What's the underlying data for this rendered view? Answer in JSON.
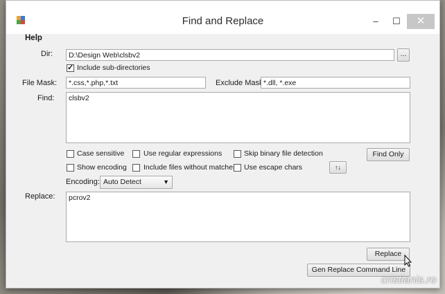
{
  "window": {
    "title": "Find and Replace"
  },
  "titlebar": {
    "min_glyph": "–",
    "max_glyph": "☐",
    "close_glyph": "✕"
  },
  "menu": {
    "help": "Help"
  },
  "dir": {
    "label": "Dir:",
    "value": "D:\\Design Web\\clsbv2",
    "browse_label": "..."
  },
  "subdirs": {
    "label": "Include sub-directories",
    "checked": true
  },
  "file_mask": {
    "label": "File Mask:",
    "value": "*.css,*.php,*.txt"
  },
  "exclude_mask": {
    "label": "Exclude Mask:",
    "value": "*.dll, *.exe"
  },
  "find": {
    "label": "Find:",
    "value": "clsbv2"
  },
  "options": {
    "case_sensitive": "Case sensitive",
    "regex": "Use regular expressions",
    "skip_binary": "Skip binary file detection",
    "show_encoding": "Show encoding",
    "include_no_match": "Include files without matches",
    "escape_chars": "Use escape chars"
  },
  "find_only_label": "Find Only",
  "swap_label": "↑↓",
  "encoding": {
    "label": "Encoding:",
    "value": "Auto Detect"
  },
  "replace": {
    "label": "Replace:",
    "value": "pcrov2"
  },
  "replace_button": "Replace",
  "gen_command_button": "Gen Replace Command Line",
  "watermark": "cristianis.ro"
}
